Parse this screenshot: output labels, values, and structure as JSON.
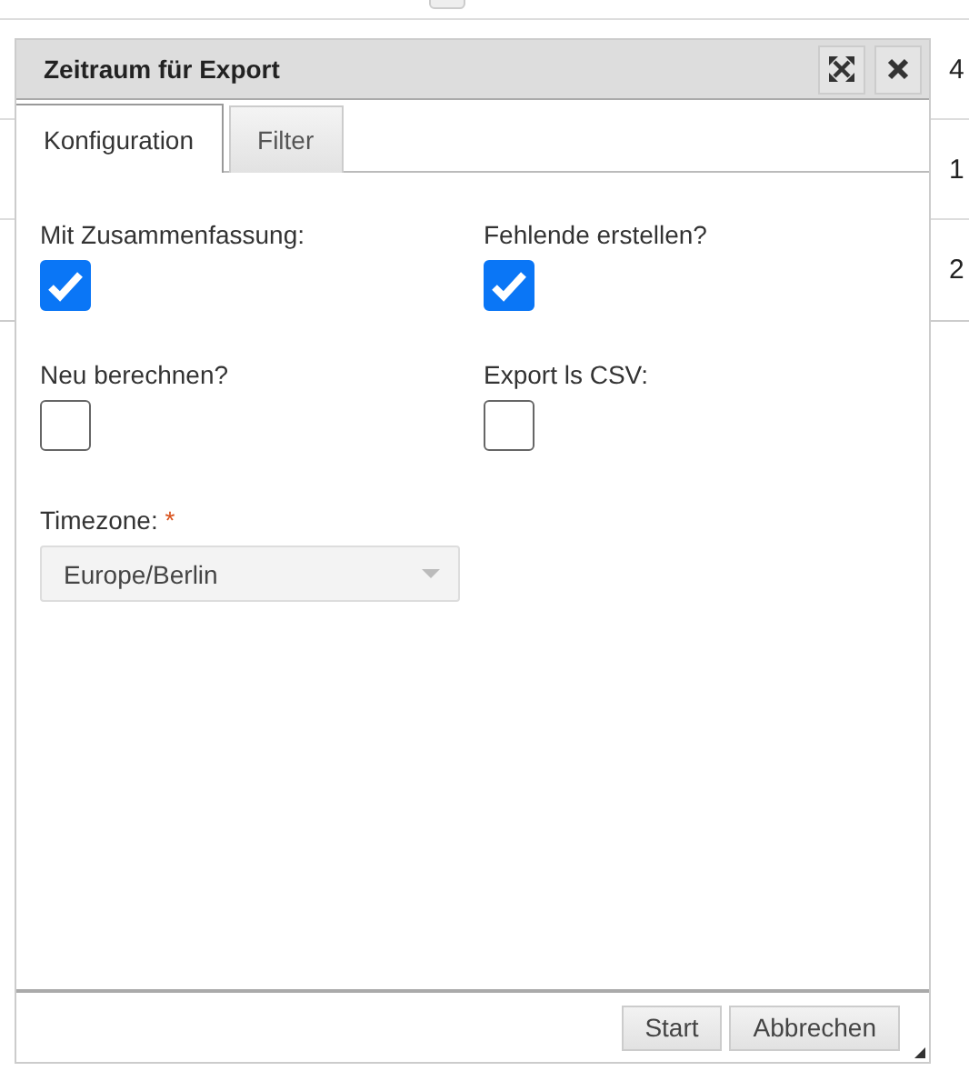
{
  "background_table": {
    "rows": [
      {
        "column_1": "4"
      },
      {
        "column_1": "1"
      },
      {
        "column_1": "2"
      }
    ]
  },
  "dialog": {
    "title": "Zeitraum für Export",
    "tabs": [
      {
        "label": "Konfiguration",
        "selected": true
      },
      {
        "label": "Filter",
        "selected": false
      }
    ],
    "checkboxes": [
      {
        "label": "Mit Zusammenfassung:",
        "checked": true
      },
      {
        "label": "Fehlende erstellen?",
        "checked": true
      },
      {
        "label": "Neu berechnen?",
        "checked": false
      },
      {
        "label": "Export ls CSV:",
        "checked": false
      }
    ],
    "timezone": {
      "label": "Timezone:",
      "required_mark": "*",
      "value": "Europe/Berlin"
    },
    "buttons": [
      "Start",
      "Abbrechen"
    ]
  }
}
